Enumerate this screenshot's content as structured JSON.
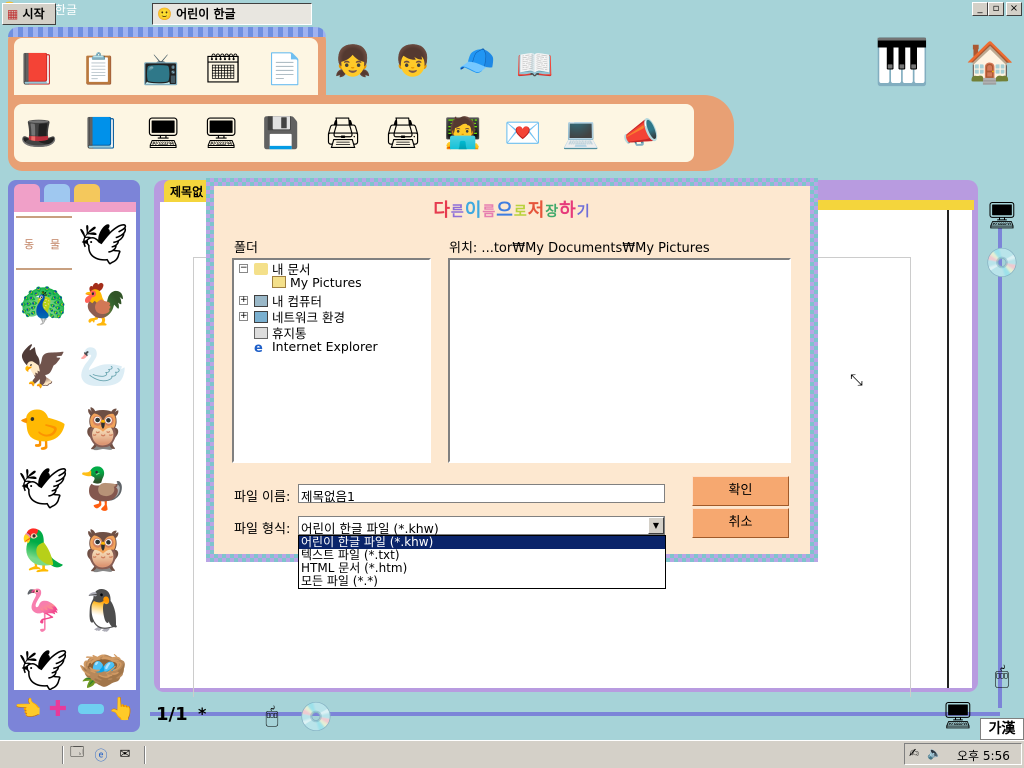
{
  "window": {
    "title": "어린이 한글",
    "min": "_",
    "max": "▫",
    "close": "×"
  },
  "toolbar_top": {
    "icons": [
      "pen-book-icon",
      "clipboard-icon",
      "tv-glasses-icon",
      "grid-hand-icon",
      "document-icon",
      "girl-face-icon",
      "boy-face-icon",
      "cap-boy-icon",
      "open-book-icon"
    ]
  },
  "toolbar_bottom": {
    "icons": [
      "magic-hat-icon",
      "book-hand-icon",
      "computer-hand-icon",
      "computer-paint-icon",
      "computer-disk-icon",
      "printer-icon",
      "printer-paper-icon",
      "person-computer-icon",
      "stamp-icon",
      "heart-computer-icon",
      "book-pink-icon",
      "speaker-icon"
    ]
  },
  "doc": {
    "tab": "제목없",
    "page_indicator": "1/1",
    "modified": "*"
  },
  "dialog": {
    "title_chars": [
      "다",
      "른",
      "이",
      "름",
      "으",
      "로",
      "저",
      "장",
      "하",
      "기"
    ],
    "title_colors": [
      "#e63b4f",
      "#8f6fd8",
      "#3fa9e0",
      "#e67fb0",
      "#3f7de0",
      "#b8d23c",
      "#e6553b",
      "#3fa96a",
      "#e63b7b",
      "#6f6fd8"
    ],
    "folder_label": "폴더",
    "location_label": "위치: ...tor₩My Documents₩My Pictures",
    "tree": [
      {
        "label": "내 문서",
        "indent": 0,
        "toggle": "−"
      },
      {
        "label": "My Pictures",
        "indent": 1,
        "toggle": ""
      },
      {
        "label": "내 컴퓨터",
        "indent": 0,
        "toggle": "+"
      },
      {
        "label": "네트워크 환경",
        "indent": 0,
        "toggle": "+"
      },
      {
        "label": "휴지통",
        "indent": 0,
        "toggle": ""
      },
      {
        "label": "Internet Explorer",
        "indent": 0,
        "toggle": ""
      }
    ],
    "filename_label": "파일 이름:",
    "filename_value": "제목없음1",
    "filetype_label": "파일 형식:",
    "filetype_value": "어린이 한글 파일 (*.khw)",
    "filetype_options": [
      "어린이 한글 파일 (*.khw)",
      "텍스트 파일 (*.txt)",
      "HTML 문서 (*.htm)",
      "모든 파일 (*.*)"
    ],
    "ok": "확인",
    "cancel": "취소"
  },
  "left_panel": {
    "label_a": "동",
    "label_b": "물"
  },
  "ime": "가漢",
  "taskbar": {
    "start": "시작",
    "app": "어린이 한글",
    "clock": "오후 5:56"
  }
}
